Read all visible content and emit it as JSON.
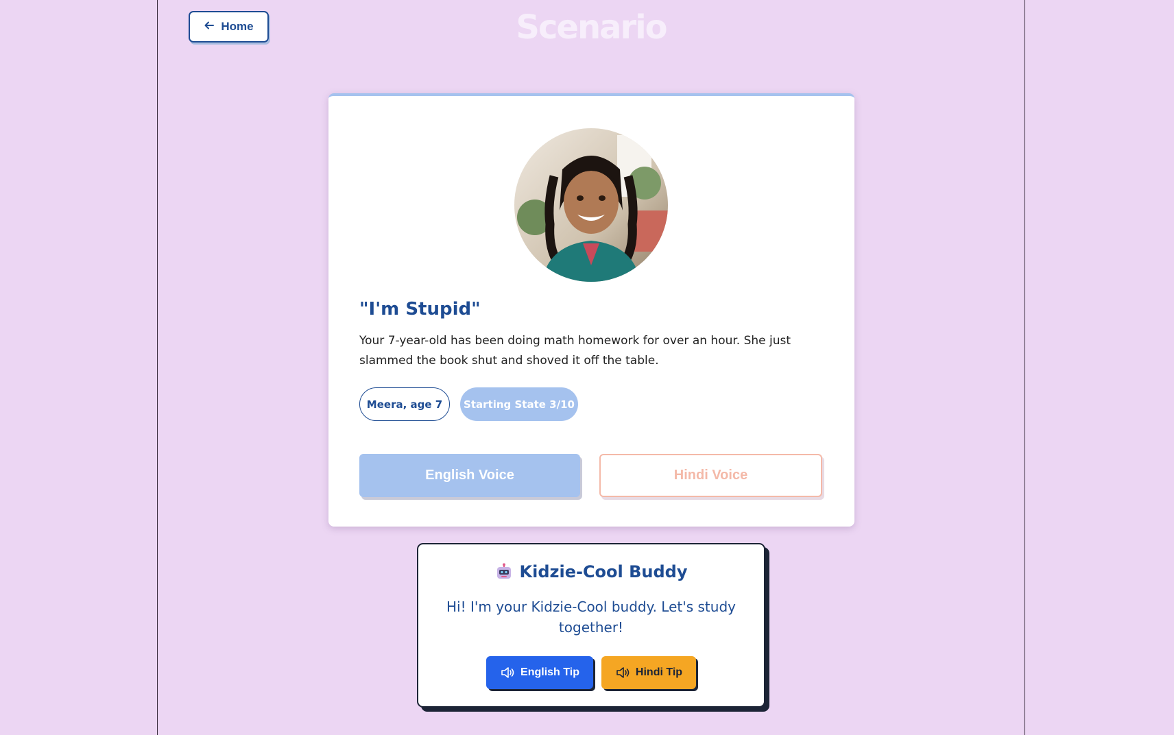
{
  "header": {
    "back_label": "Home",
    "title": "Scenario"
  },
  "scenario": {
    "avatar_alt": "Meera",
    "title": "\"I'm Stupid\"",
    "description": "Your 7-year-old has been doing math homework for over an hour. She just slammed the book shut and shoved it off the table.",
    "child_chip": "Meera, age 7",
    "state_chip": "Starting State 3/10",
    "english_voice_label": "English Voice",
    "hindi_voice_label": "Hindi Voice"
  },
  "buddy": {
    "icon": "robot-icon",
    "title": "Kidzie-Cool Buddy",
    "message": "Hi! I'm your Kidzie-Cool buddy. Let's study together!",
    "english_tip_label": "English Tip",
    "hindi_tip_label": "Hindi Tip",
    "tip_icon": "speaker-icon"
  },
  "colors": {
    "background": "#ecd6f3",
    "primary": "#1e4c93",
    "english_voice": "#a5c2ee",
    "hindi_voice": "#f4b9a8",
    "english_tip": "#2563eb",
    "hindi_tip": "#f5a623"
  }
}
